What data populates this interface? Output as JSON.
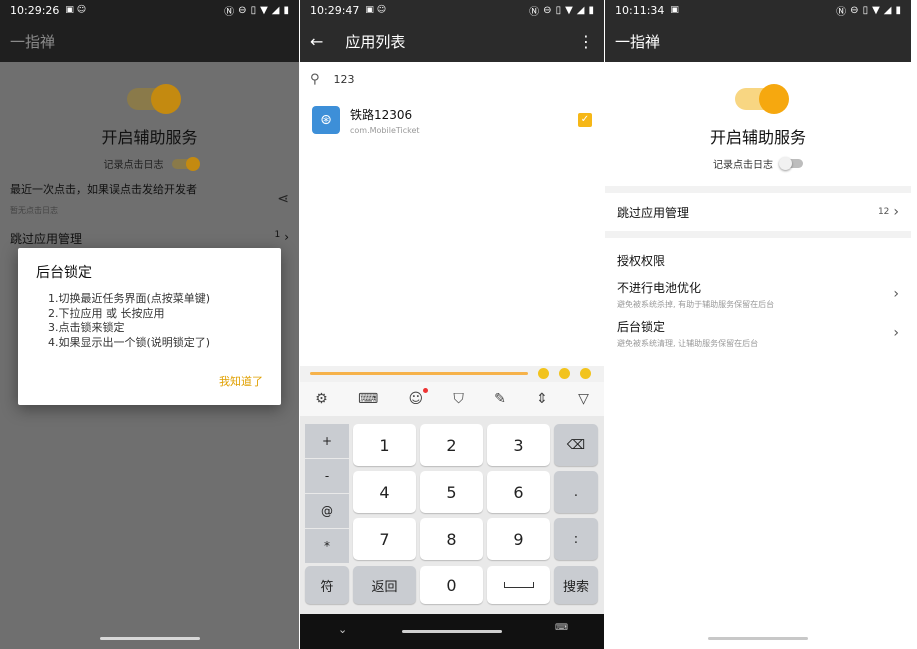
{
  "panel1": {
    "time": "10:29:26",
    "app_title": "一指禅",
    "main_title": "开启辅助服务",
    "log_label": "记录点击日志",
    "last_click_label": "最近一次点击，如果误点击发给开发者",
    "last_click_sub": "暂无点击日志",
    "skip_label": "跳过应用管理",
    "skip_count": "1",
    "dialog": {
      "title": "后台锁定",
      "lines": [
        "1.切换最近任务界面(点按菜单键)",
        "2.下拉应用 或 长按应用",
        "3.点击锁来锁定",
        "4.如果显示出一个锁(说明锁定了)"
      ],
      "ok_label": "我知道了"
    },
    "colors": {
      "accent": "#f6b717"
    }
  },
  "panel2": {
    "time": "10:29:47",
    "title": "应用列表",
    "search_value": "123",
    "app": {
      "name": "铁路12306",
      "package": "com.MobileTicket",
      "checked": true
    },
    "keyboard": {
      "left_keys": [
        "+",
        "-",
        "@",
        "*"
      ],
      "digits": [
        "1",
        "2",
        "3",
        "4",
        "5",
        "6",
        "7",
        "8",
        "9",
        "0"
      ],
      "right_keys": [
        ".",
        ":"
      ],
      "wait_label": "符",
      "back_label": "返回",
      "search_label": "搜索"
    }
  },
  "panel3": {
    "time": "10:11:34",
    "app_title": "一指禅",
    "main_title": "开启辅助服务",
    "log_label": "记录点击日志",
    "skip_label": "跳过应用管理",
    "skip_count": "12",
    "auth_title": "授权权限",
    "items": [
      {
        "title": "不进行电池优化",
        "sub": "避免被系统杀掉, 有助于辅助服务保留在后台"
      },
      {
        "title": "后台锁定",
        "sub": "避免被系统清理, 让辅助服务保留在后台"
      }
    ]
  }
}
